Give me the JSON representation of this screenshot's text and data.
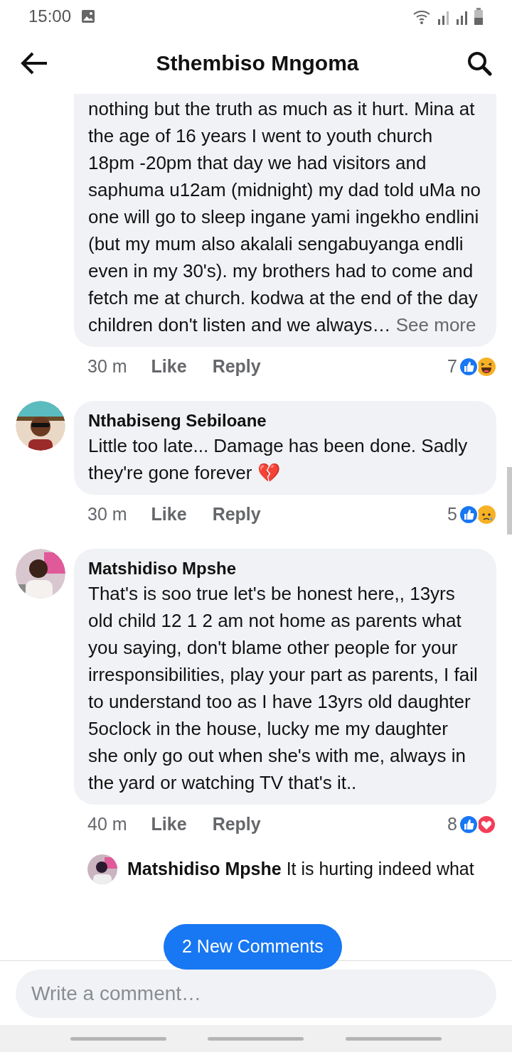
{
  "status_bar": {
    "time": "15:00"
  },
  "header": {
    "title": "Sthembiso Mngoma"
  },
  "comments": [
    {
      "text": "nothing but the truth as much as it hurt. Mina at the age of 16 years I went to youth church 18pm -20pm that day we had visitors and saphuma u12am (midnight) my dad told uMa no one will go to sleep ingane yami ingekho endlini (but my mum also akalali sengabuyanga endli even in my 30's). my brothers had to come and fetch me at church.  kodwa at the end of the day children don't listen and we always…",
      "see_more": "See more",
      "time": "30 m",
      "like": "Like",
      "reply": "Reply",
      "count": "7",
      "reactions": [
        {
          "kind": "like"
        },
        {
          "kind": "haha"
        }
      ]
    },
    {
      "author": "Nthabiseng Sebiloane",
      "text": "Little too late... Damage has been done. Sadly they're gone forever",
      "emoji": "💔",
      "time": "30 m",
      "like": "Like",
      "reply": "Reply",
      "count": "5",
      "reactions": [
        {
          "kind": "like"
        },
        {
          "kind": "sad"
        }
      ]
    },
    {
      "author": "Matshidiso Mpshe",
      "text": "That's is soo true let's be honest here,, 13yrs old child 12 1 2 am not home as parents what you saying, don't blame other people for your irresponsibilities, play your part as parents, I fail to understand too as I have 13yrs old daughter 5oclock in the house, lucky me my daughter she only go out when she's with me, always in the yard or watching TV that's it..",
      "time": "40 m",
      "like": "Like",
      "reply": "Reply",
      "count": "8",
      "reactions": [
        {
          "kind": "like"
        },
        {
          "kind": "love"
        }
      ]
    }
  ],
  "reply": {
    "author": "Matshidiso Mpshe",
    "text": "It is hurting indeed what"
  },
  "new_comments_button": "2 New Comments",
  "composer": {
    "placeholder": "Write a comment…"
  }
}
